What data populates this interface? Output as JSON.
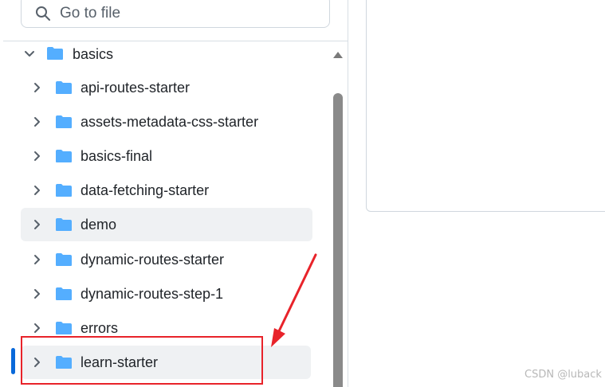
{
  "search": {
    "placeholder": "Go to file"
  },
  "tree": {
    "root": {
      "label": "basics",
      "expanded": true
    },
    "items": [
      {
        "label": "api-routes-starter",
        "selected": false
      },
      {
        "label": "assets-metadata-css-starter",
        "selected": false
      },
      {
        "label": "basics-final",
        "selected": false
      },
      {
        "label": "data-fetching-starter",
        "selected": false
      },
      {
        "label": "demo",
        "selected": true
      },
      {
        "label": "dynamic-routes-starter",
        "selected": false
      },
      {
        "label": "dynamic-routes-step-1",
        "selected": false
      },
      {
        "label": "errors",
        "selected": false
      },
      {
        "label": "learn-starter",
        "selected": true
      }
    ]
  },
  "colors": {
    "folder": "#54aeff",
    "accent": "#0969da",
    "annotation": "#e8232a",
    "selected_bg": "#eff1f3"
  },
  "watermark": "CSDN @luback"
}
